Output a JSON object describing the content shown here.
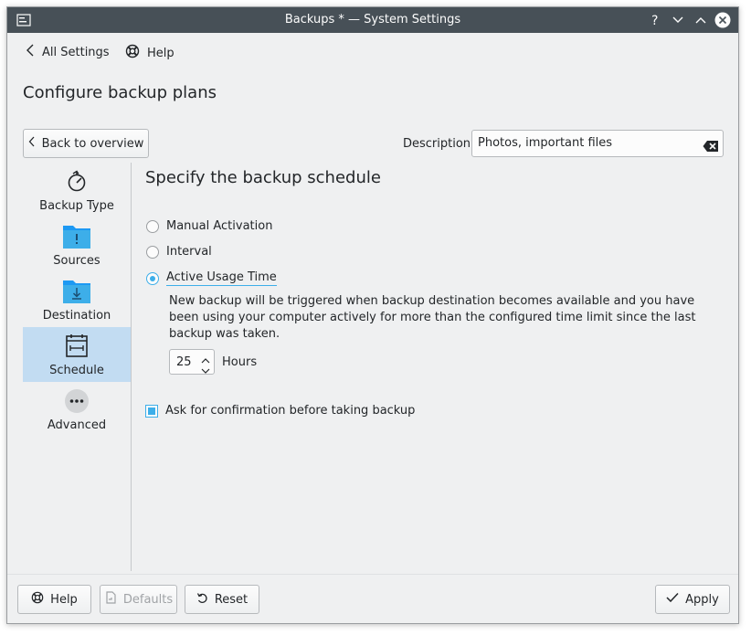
{
  "window": {
    "title": "Backups * — System Settings"
  },
  "nav": {
    "all_settings": "All Settings",
    "help": "Help"
  },
  "page": {
    "title": "Configure backup plans",
    "back_button": "Back to overview",
    "description_label": "Description:",
    "description_value": "Photos, important files"
  },
  "sidebar": {
    "items": [
      {
        "label": "Backup Type",
        "icon": "backup-type-icon"
      },
      {
        "label": "Sources",
        "icon": "folder-important-icon"
      },
      {
        "label": "Destination",
        "icon": "folder-download-icon"
      },
      {
        "label": "Schedule",
        "icon": "calendar-icon",
        "selected": true
      },
      {
        "label": "Advanced",
        "icon": "more-icon"
      }
    ]
  },
  "schedule": {
    "title": "Specify the backup schedule",
    "options": [
      {
        "label": "Manual Activation",
        "checked": false
      },
      {
        "label": "Interval",
        "checked": false
      },
      {
        "label": "Active Usage Time",
        "checked": true
      }
    ],
    "explanation": "New backup will be triggered when backup destination becomes available and you have been using your computer actively for more than the configured time limit since the last backup was taken.",
    "hours_value": "25",
    "hours_unit": "Hours",
    "confirm_label": "Ask for confirmation before taking backup",
    "confirm_checked": true
  },
  "footer": {
    "help": "Help",
    "defaults": "Defaults",
    "reset": "Reset",
    "apply": "Apply"
  },
  "colors": {
    "accent": "#3daee9",
    "selection": "#c2dcf2",
    "titlebar": "#475057",
    "window_bg": "#eff0f1"
  }
}
